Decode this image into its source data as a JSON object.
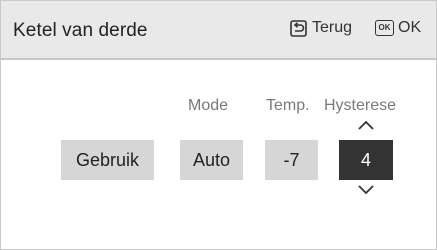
{
  "header": {
    "title": "Ketel van derde",
    "back_label": "Terug",
    "ok_icon_text": "OK",
    "ok_label": "OK"
  },
  "columns": {
    "mode_label": "Mode",
    "temp_label": "Temp.",
    "hysteresis_label": "Hysterese"
  },
  "values": {
    "usage": "Gebruik",
    "mode": "Auto",
    "temp": "-7",
    "hysteresis": "4"
  },
  "icons": {
    "back": "return-arrow-icon",
    "ok": "ok-key-icon",
    "up": "chevron-up-icon",
    "down": "chevron-down-icon"
  },
  "colors": {
    "header_bg": "#e9e9e9",
    "cell_bg": "#d6d6d6",
    "selected_bg": "#333333",
    "label": "#7a7a7a"
  }
}
